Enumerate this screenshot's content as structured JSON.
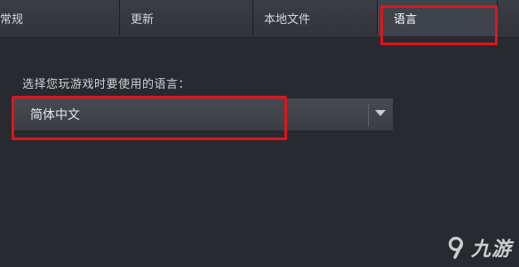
{
  "tabs": [
    {
      "label": "常规"
    },
    {
      "label": "更新"
    },
    {
      "label": "本地文件"
    },
    {
      "label": "语言",
      "active": true
    }
  ],
  "language_prompt": "选择您玩游戏时要使用的语言：",
  "language_select": {
    "value": "简体中文",
    "icon": "chevron-down-icon"
  },
  "highlight_color": "#e0141b",
  "watermark": {
    "text": "九游",
    "icon": "9game-logo-icon"
  }
}
